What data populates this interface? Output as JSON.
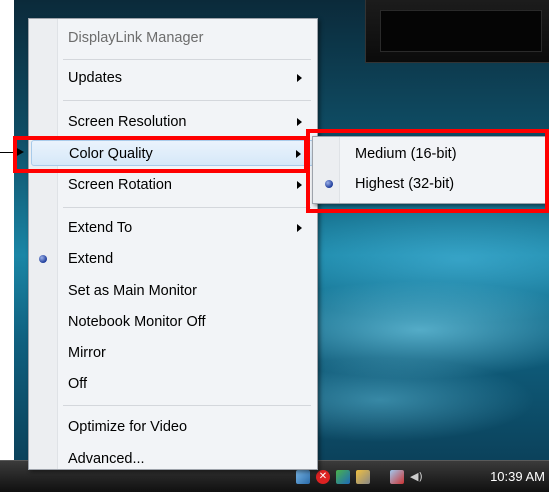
{
  "menu": {
    "header": "DisplayLink Manager",
    "items": [
      {
        "label": "Updates",
        "submenu": true
      },
      {
        "label": "Screen Resolution",
        "submenu": true
      },
      {
        "label": "Color Quality",
        "submenu": true,
        "highlighted": true
      },
      {
        "label": "Screen Rotation",
        "submenu": true
      },
      {
        "label": "Extend To",
        "submenu": true
      },
      {
        "label": "Extend",
        "checked": true
      },
      {
        "label": "Set as Main Monitor"
      },
      {
        "label": "Notebook Monitor Off"
      },
      {
        "label": "Mirror"
      },
      {
        "label": "Off"
      },
      {
        "label": "Optimize for Video"
      },
      {
        "label": "Advanced..."
      }
    ]
  },
  "submenu": {
    "items": [
      {
        "label": "Medium (16-bit)",
        "checked": false
      },
      {
        "label": "Highest (32-bit)",
        "checked": true
      }
    ]
  },
  "taskbar": {
    "clock": "10:39 AM",
    "tray_icons": [
      "network-icon",
      "blocked-icon",
      "displaylink-icon",
      "monitor-icon",
      "network-alert-icon",
      "volume-icon"
    ]
  },
  "colors": {
    "annotation": "#ff0000",
    "highlight": "#d6e8f8",
    "radio": "#1d3b9a"
  }
}
